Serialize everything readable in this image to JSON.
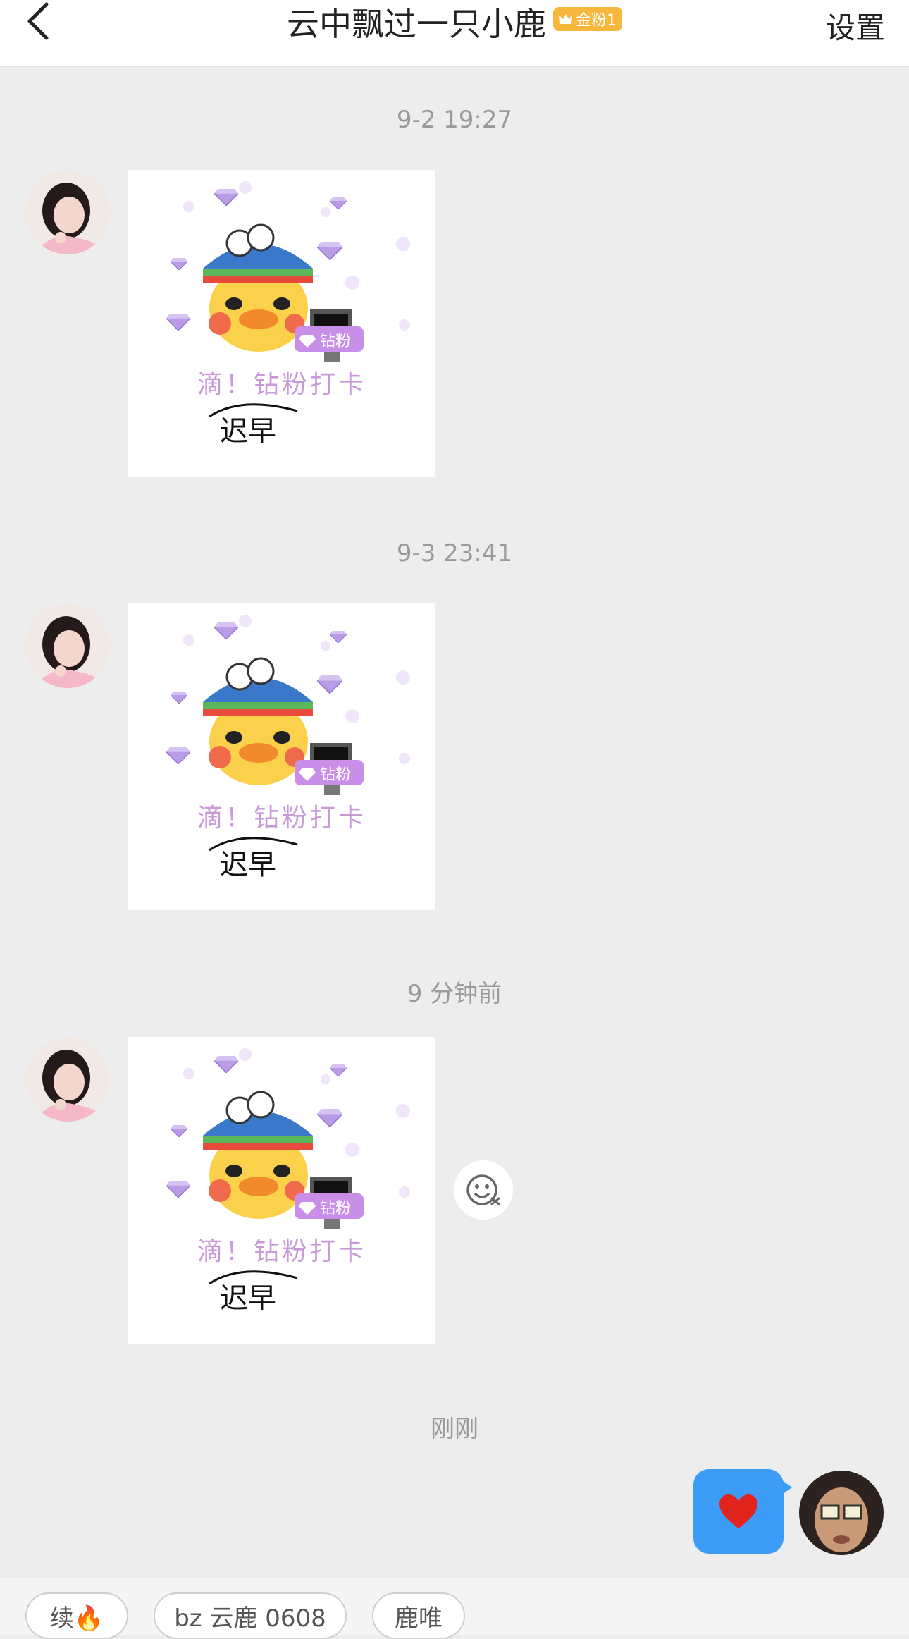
{
  "header": {
    "title": "云中飘过一只小鹿",
    "fan_badge": "金粉1",
    "settings_label": "设置"
  },
  "messages": [
    {
      "timestamp": "9-2 19:27"
    },
    {
      "timestamp": "9-3 23:41"
    },
    {
      "timestamp": "9 分钟前"
    },
    {
      "timestamp": "刚刚"
    }
  ],
  "sticker": {
    "badge": "钻粉",
    "caption": "滴！钻粉打卡",
    "handwriting": "迟早"
  },
  "my_message": {
    "icon": "heart-icon"
  },
  "quick_replies": [
    {
      "label": "续🔥"
    },
    {
      "label": "bz 云鹿 0608"
    },
    {
      "label": "鹿唯"
    }
  ],
  "colors": {
    "background": "#ededed",
    "my_bubble": "#3d9cf5",
    "fan_badge": "#f6b73c",
    "sticker_text": "#c99ad8",
    "gem": "#a98bd9"
  }
}
